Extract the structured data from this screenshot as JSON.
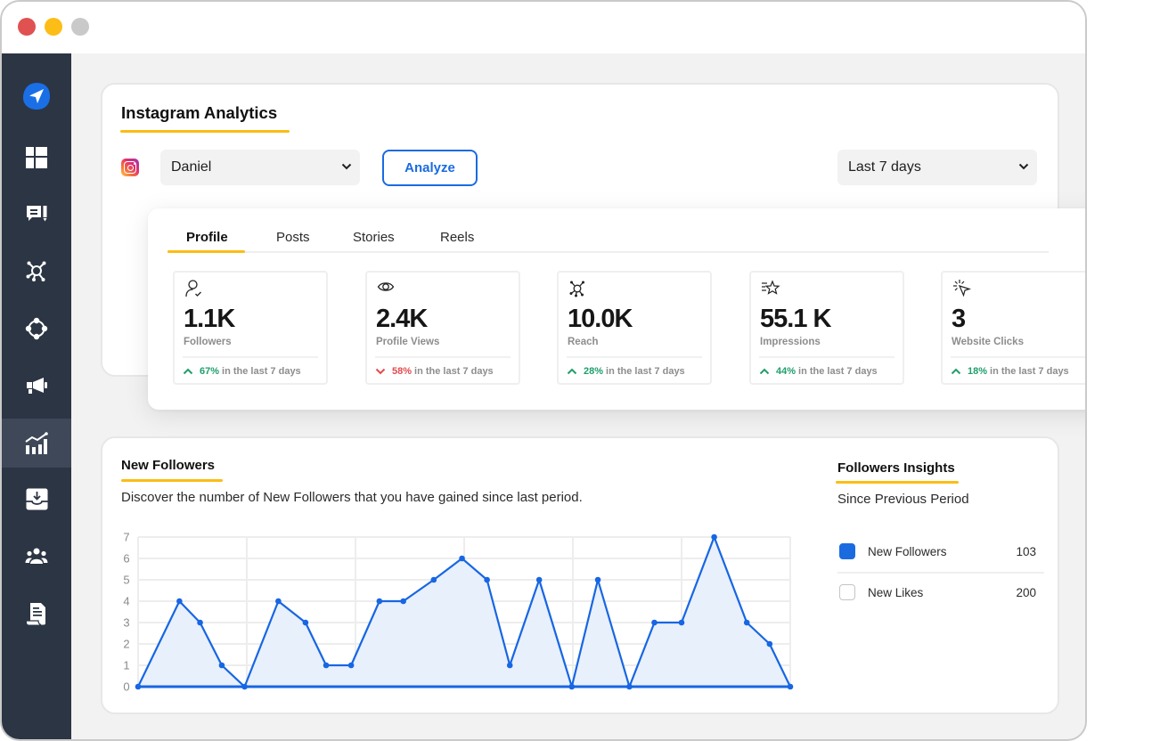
{
  "window": {
    "traffic_lights": [
      {
        "name": "close",
        "color": "#e05151"
      },
      {
        "name": "minimize",
        "color": "#fdbd17"
      },
      {
        "name": "maximize",
        "color": "#c9c9c9"
      }
    ]
  },
  "sidebar": {
    "active_index": 6,
    "items": [
      {
        "icon": "send-logo-icon"
      },
      {
        "icon": "dashboard-icon"
      },
      {
        "icon": "messages-edit-icon"
      },
      {
        "icon": "network-hub-icon"
      },
      {
        "icon": "connections-icon"
      },
      {
        "icon": "megaphone-icon"
      },
      {
        "icon": "analytics-icon"
      },
      {
        "icon": "inbox-download-icon"
      },
      {
        "icon": "team-icon"
      },
      {
        "icon": "document-icon"
      }
    ]
  },
  "header": {
    "title": "Instagram Analytics",
    "platform_icon": "instagram-icon",
    "account_select": {
      "value": "Daniel"
    },
    "analyze_label": "Analyze",
    "period_select": {
      "value": "Last 7 days"
    }
  },
  "tabs": [
    {
      "label": "Profile",
      "active": true
    },
    {
      "label": "Posts",
      "active": false
    },
    {
      "label": "Stories",
      "active": false
    },
    {
      "label": "Reels",
      "active": false
    }
  ],
  "stats": [
    {
      "icon": "user-check-icon",
      "value": "1.1K",
      "label": "Followers",
      "trend": "up",
      "change": "67%",
      "period_text": "in the last 7 days"
    },
    {
      "icon": "eye-icon",
      "value": "2.4K",
      "label": "Profile Views",
      "trend": "down",
      "change": "58%",
      "period_text": "in the last 7 days"
    },
    {
      "icon": "reach-hub-icon",
      "value": "10.0K",
      "label": "Reach",
      "trend": "up",
      "change": "28%",
      "period_text": "in the last 7 days"
    },
    {
      "icon": "star-lines-icon",
      "value": "55.1 K",
      "label": "Impressions",
      "trend": "up",
      "change": "44%",
      "period_text": "in the last 7 days"
    },
    {
      "icon": "cursor-click-icon",
      "value": "3",
      "label": "Website Clicks",
      "trend": "up",
      "change": "18%",
      "period_text": "in the last 7 days"
    }
  ],
  "new_followers": {
    "title": "New Followers",
    "description": "Discover the number of New Followers that you have gained since last period."
  },
  "insights": {
    "title": "Followers Insights",
    "subtitle": "Since Previous Period",
    "items": [
      {
        "label": "New Followers",
        "value": "103",
        "checked": true
      },
      {
        "label": "New Likes",
        "value": "200",
        "checked": false
      }
    ]
  },
  "colors": {
    "accent": "#1a6be0",
    "title_underline": "#fbbd14",
    "trend_up": "#1f9e6c",
    "trend_down": "#e34a4f",
    "sidebar_bg": "#2c3544",
    "chart_line": "#1766e3",
    "chart_fill": "#e8f0fc"
  },
  "chart_data": {
    "type": "area",
    "title": "New Followers",
    "xlabel": "",
    "ylabel": "",
    "x": [
      0,
      0.38,
      0.57,
      0.77,
      0.98,
      1.29,
      1.54,
      1.73,
      1.96,
      2.22,
      2.44,
      2.72,
      2.98,
      3.21,
      3.42,
      3.69,
      3.99,
      4.23,
      4.52,
      4.75,
      5.0,
      5.3,
      5.6,
      5.81,
      6.0
    ],
    "values": [
      0,
      4,
      3,
      1,
      0,
      4,
      3,
      1,
      1,
      4,
      4,
      5,
      6,
      5,
      1,
      5,
      0,
      5,
      0,
      3,
      3,
      7,
      3,
      2,
      0
    ],
    "xlim": [
      0,
      6
    ],
    "ylim": [
      0,
      7
    ],
    "yticks": [
      0,
      1,
      2,
      3,
      4,
      5,
      6,
      7
    ],
    "xgrid": [
      0,
      1,
      2,
      3,
      4,
      5,
      6
    ],
    "grid": true,
    "legend": "none"
  }
}
